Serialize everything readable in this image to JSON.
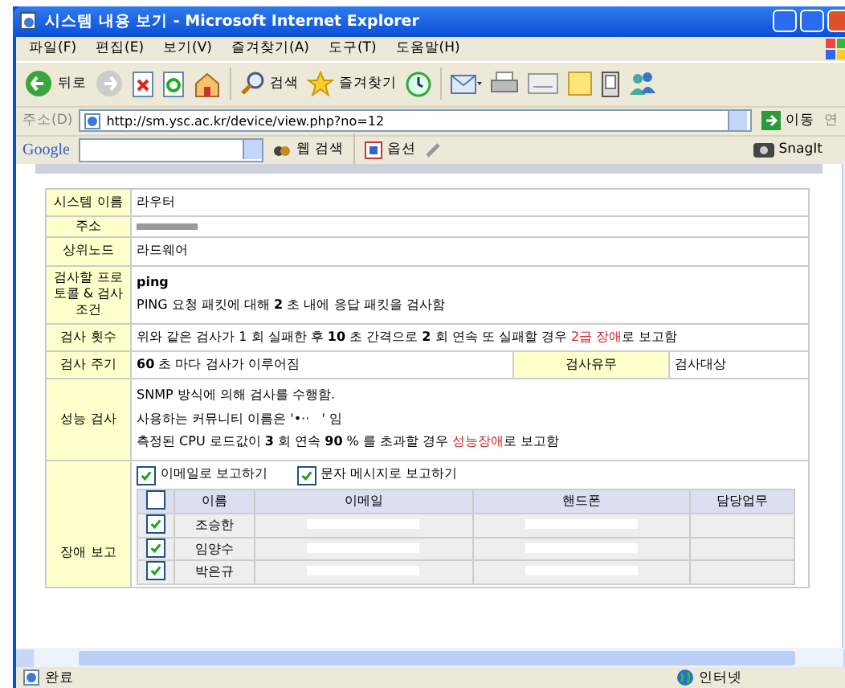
{
  "window": {
    "title": "시스템 내용 보기 - Microsoft Internet Explorer"
  },
  "menu": [
    "파일(F)",
    "편집(E)",
    "보기(V)",
    "즐겨찾기(A)",
    "도구(T)",
    "도움말(H)"
  ],
  "toolbar": {
    "back": "뒤로",
    "search": "검색",
    "favorites": "즐겨찾기"
  },
  "address_bar": {
    "label": "주소(D)",
    "url": "http://sm.ysc.ac.kr/device/view.php?no=12",
    "go": "이동",
    "links": "연"
  },
  "google_bar": {
    "logo": "Google",
    "search_button": "웹 검색",
    "options": "옵션",
    "snagit": "SnagIt"
  },
  "details": [
    {
      "label": "시스템 이름",
      "lines": [
        [
          {
            "kind": "text",
            "text": "라우터"
          }
        ]
      ]
    },
    {
      "label": "주소",
      "redacted": true
    },
    {
      "label": "상위노드",
      "lines": [
        [
          {
            "kind": "text",
            "text": "라드웨어"
          }
        ]
      ]
    },
    {
      "label": "검사할 프로토콜 & 검사 조건",
      "lines": [
        [
          {
            "kind": "strong",
            "text": "ping"
          }
        ],
        [
          {
            "kind": "text",
            "text": "PING 요청 패킷에 대해 **2** 초 내에 응답 패킷을 검사함"
          }
        ]
      ]
    },
    {
      "label": "검사 횟수",
      "lines": [
        [
          {
            "kind": "text",
            "text": "위와 같은 검사가 1 회 실패한 후 **10** 초 간격으로 **2** 회 연속 또 실패할 경우 "
          },
          {
            "kind": "alert",
            "text": "2급 장애"
          },
          {
            "kind": "text",
            "text": "로 보고함"
          }
        ]
      ]
    },
    {
      "label": "검사 주기",
      "lines": [
        [
          {
            "kind": "text",
            "text": "**60** 초 마다 검사가 이루어짐"
          }
        ]
      ],
      "extra_label": "검사유무",
      "extra_value": "검사대상"
    },
    {
      "label": "성능 검사",
      "lines": [
        [
          {
            "kind": "text",
            "text": "SNMP 방식에 의해 검사를 수행함."
          }
        ],
        [
          {
            "kind": "text",
            "text": "사용하는 커뮤니티 이름은 '•··   ' 임"
          }
        ],
        [
          {
            "kind": "text",
            "text": "측정된 CPU 로드값이 **3** 회 연속 **90** % 를 초과할 경우 "
          },
          {
            "kind": "alert",
            "text": "성능장애"
          },
          {
            "kind": "text",
            "text": "로 보고함"
          }
        ]
      ]
    }
  ],
  "report": {
    "label": "장애 보고",
    "options": [
      {
        "label": "이메일로 보고하기",
        "checked": true
      },
      {
        "label": "문자 메시지로 보고하기",
        "checked": true
      }
    ],
    "select_all": false,
    "columns": [
      "이름",
      "이메일",
      "핸드폰",
      "담당업무"
    ],
    "rows": [
      {
        "checked": true,
        "name": "조승한"
      },
      {
        "checked": true,
        "name": "임양수"
      },
      {
        "checked": true,
        "name": "박은규"
      }
    ]
  },
  "status_bar": {
    "status": "완료",
    "zone": "인터넷"
  }
}
